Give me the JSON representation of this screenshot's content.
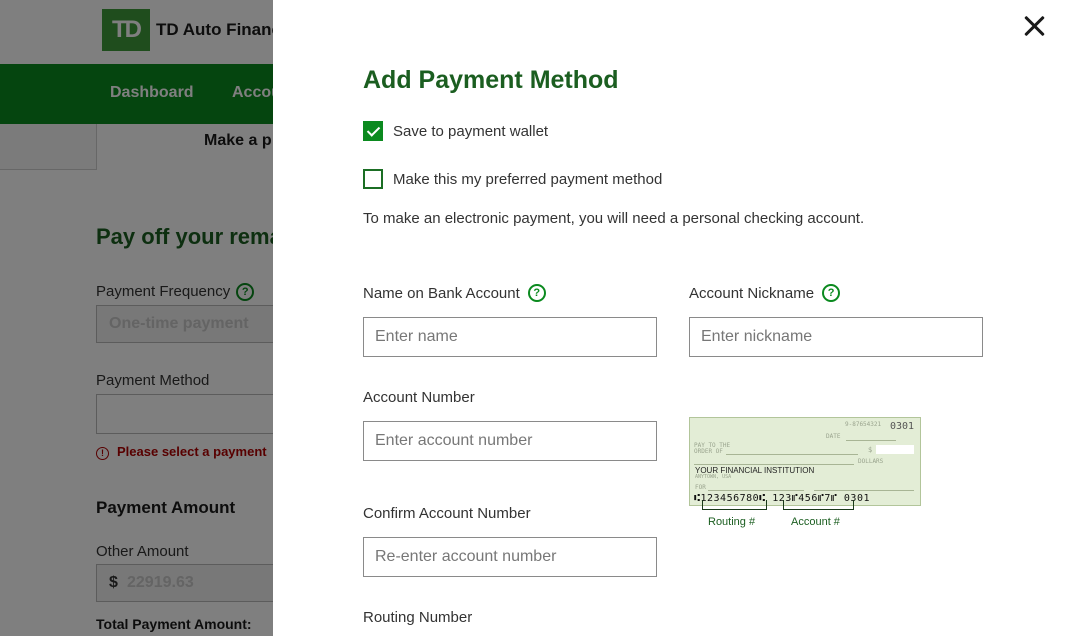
{
  "background": {
    "logo": {
      "mark": "TD",
      "text": "TD Auto Financ"
    },
    "nav": [
      "Dashboard",
      "Accou"
    ],
    "active_tab": "Make a p",
    "heading": "Pay off your rema",
    "payment_frequency": {
      "label": "Payment Frequency",
      "value": "One-time payment"
    },
    "payment_method": {
      "label": "Payment Method",
      "error": "Please select a payment"
    },
    "payment_amount": {
      "heading": "Payment Amount",
      "other_label": "Other Amount",
      "currency": "$",
      "value": "22919.63"
    },
    "total_label": "Total Payment Amount:"
  },
  "modal": {
    "title": "Add Payment Method",
    "save_to_wallet": {
      "label": "Save to payment wallet",
      "checked": true
    },
    "preferred": {
      "label": "Make this my preferred payment method",
      "checked": false
    },
    "info": "To make an electronic payment, you will need a personal checking account.",
    "name_on_account": {
      "label": "Name on Bank Account",
      "placeholder": "Enter name"
    },
    "nickname": {
      "label": "Account Nickname",
      "placeholder": "Enter nickname"
    },
    "account_number": {
      "label": "Account Number",
      "placeholder": "Enter account number"
    },
    "confirm_account_number": {
      "label": "Confirm Account Number",
      "placeholder": "Re-enter account number"
    },
    "routing_number": {
      "label": "Routing Number"
    },
    "check_image": {
      "check_no": "0301",
      "fraction": "9-87654321",
      "date": "DATE",
      "pay_to": "PAY TO THE",
      "order_of": "ORDER OF",
      "dollar_sign": "$",
      "dollars": "DOLLARS",
      "bank_name": "YOUR FINANCIAL INSTITUTION",
      "bank_city": "ANYTOWN, USA",
      "for": "FOR",
      "micr_routing": "⑆123456780⑆",
      "micr_account": "123⑈456⑈7⑈",
      "micr_check": "0301",
      "routing_label": "Routing #",
      "account_label": "Account #"
    }
  },
  "colors": {
    "brand_green": "#0b8a1f",
    "title_green": "#1b5e20",
    "check_bg": "#e3edd6"
  },
  "icons": {
    "close": "close-icon",
    "help": "help-circle-icon",
    "error": "alert-circle-icon",
    "check": "checkmark-icon"
  }
}
